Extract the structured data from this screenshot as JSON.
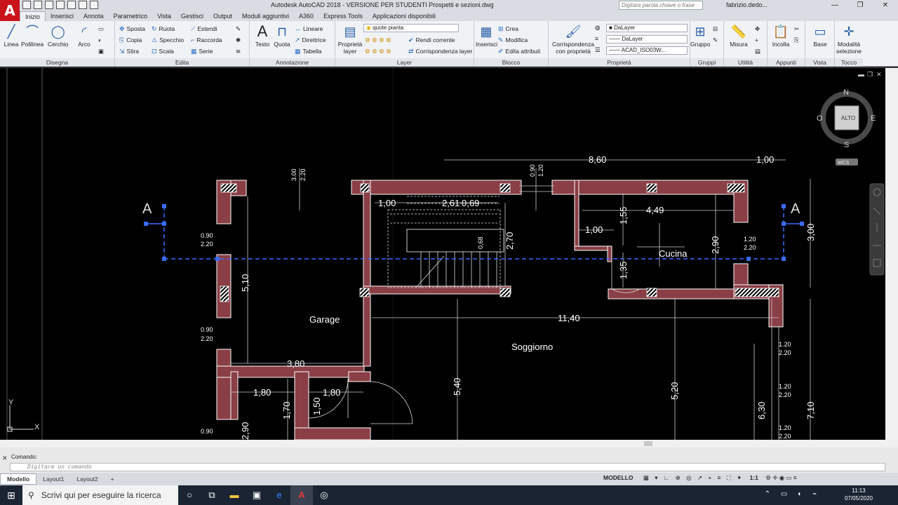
{
  "window": {
    "title": "Autodesk AutoCAD 2018 - VERSIONE PER STUDENTI    Prospetti e sezioni.dwg",
    "search_placeholder": "Digitare parola chiave o frase",
    "user": "fabrizio.dedo...",
    "app_letter": "A"
  },
  "tabs": [
    "Inizio",
    "Inserisci",
    "Annota",
    "Parametrico",
    "Vista",
    "Gestisci",
    "Output",
    "Moduli aggiuntivi",
    "A360",
    "Express Tools",
    "Applicazioni disponibili"
  ],
  "ribbon": {
    "draw": {
      "title": "Disegna",
      "linea": "Linea",
      "polilinea": "Polilinea",
      "cerchio": "Cerchio",
      "arco": "Arco"
    },
    "edit": {
      "title": "Edita",
      "sposta": "Sposta",
      "ruota": "Ruota",
      "estendi": "Estendi",
      "copia": "Copia",
      "specchio": "Specchio",
      "raccorda": "Raccorda",
      "stira": "Stira",
      "scala": "Scala",
      "serie": "Serie"
    },
    "annot": {
      "title": "Annotazione",
      "testo": "Testo",
      "quota": "Quota",
      "lineare": "Lineare",
      "direttrice": "Direttrice",
      "tabella": "Tabella"
    },
    "layer": {
      "title": "Layer",
      "proprieta": "Proprietà layer",
      "combo": "quote pianta",
      "rendi": "Rendi corrente",
      "corrisp": "Corrispondenza layer"
    },
    "block": {
      "title": "Blocco",
      "inserisci": "Inserisci",
      "crea": "Crea",
      "modifica": "Modifica",
      "edita": "Edita attributi"
    },
    "props": {
      "title": "Proprietà",
      "corrisp": "Corrispondenza con proprietà",
      "c1": "DaLayer",
      "c2": "DaLayer",
      "c3": "ACAD_ISO03W..."
    },
    "groups": {
      "title": "Gruppi",
      "gruppo": "Gruppo"
    },
    "util": {
      "title": "Utilità",
      "misura": "Misura"
    },
    "clip": {
      "title": "Appunti",
      "incolla": "Incolla"
    },
    "view": {
      "title": "Vista",
      "base": "Base"
    },
    "touch": {
      "title": "Tocco",
      "modalita": "Modalità selezione"
    }
  },
  "drawing": {
    "labels": {
      "garage": "Garage",
      "soggiorno": "Soggiorno",
      "cucina": "Cucina",
      "section_left": "A",
      "section_right": "A"
    },
    "dims": {
      "d860": "8,60",
      "d100a": "1,00",
      "d100b": "1,00",
      "d100c": "1,00",
      "d261": "2,61",
      "d069": "0,69",
      "d449": "4,49",
      "d155": "1,55",
      "d270": "2,70",
      "d290": "2,90",
      "d300": "3,00",
      "d510": "5,10",
      "d1140": "11,40",
      "d380": "3,80",
      "d180a": "1,80",
      "d180b": "1,80",
      "d170": "1,70",
      "d150": "1,50",
      "d540": "5,40",
      "d520": "5,20",
      "d630": "6,30",
      "d710": "7,10",
      "d135": "1,35",
      "d068": "0,68",
      "d290b": "2,90",
      "d090a": "0.90",
      "d220a": "2.20",
      "d090b": "0.90",
      "d220b": "2.20",
      "d090c": "0.90",
      "d090d": "0.90",
      "d220d": "2.20",
      "d120a": "1.20",
      "d220e": "2.20",
      "d120b": "1.20",
      "d220f": "2.20",
      "d120c": "1.20",
      "d220g": "2.20",
      "d120d": "1.20",
      "d220h": "2.20",
      "d090e": "0.90",
      "d120e": "1.20",
      "d300b": "3.00",
      "d220c": "2.20",
      "d220i": "2.20"
    }
  },
  "viewcube": {
    "n": "N",
    "s": "S",
    "e": "E",
    "o": "O",
    "top": "ALTO",
    "wcs": "WCS"
  },
  "ucs": {
    "x": "X",
    "y": "Y"
  },
  "command": {
    "history": "Comando:",
    "placeholder": "Digitare un comando"
  },
  "layout_tabs": [
    "Modello",
    "Layout1",
    "Layout2"
  ],
  "status": {
    "mode": "MODELLO",
    "scale": "1:1"
  },
  "taskbar": {
    "search": "Scrivi qui per eseguire la ricerca",
    "time": "11:13",
    "date": "07/05/2020"
  }
}
